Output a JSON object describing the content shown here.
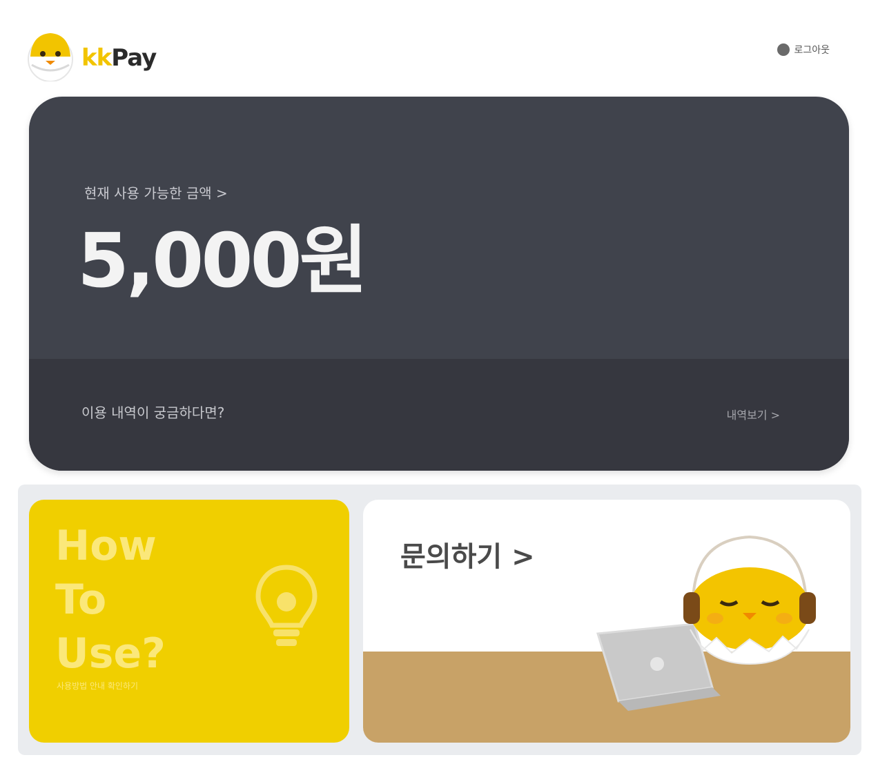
{
  "header": {
    "logo_text_accent": "kk",
    "logo_text_main": "Pay",
    "logout_label": "로그아웃",
    "logout_icon": "logout-icon"
  },
  "balance": {
    "caption": "현재 사용 가능한 금액 >",
    "amount": "5,000원",
    "footer_left": "이용 내역이 궁금하다면?",
    "footer_right": "내역보기 >"
  },
  "howto": {
    "line1": "How",
    "line2": "To",
    "line3": "Use?",
    "subtext": "사용방법 안내 확인하기",
    "icon": "lightbulb-icon"
  },
  "inquiry": {
    "label": "문의하기 >",
    "illustration": "chick-with-headset-and-laptop"
  },
  "colors": {
    "card_bg": "#40434c",
    "card_footer": "#36373f",
    "brand_yellow": "#f0cf00",
    "desk": "#c8a267"
  }
}
